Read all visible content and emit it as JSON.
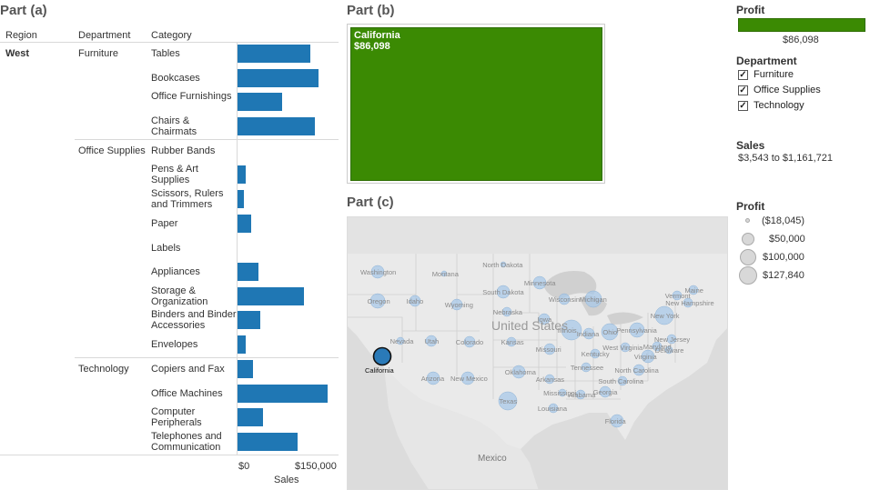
{
  "part_a": {
    "title": "Part (a)",
    "headers": {
      "region": "Region",
      "department": "Department",
      "category": "Category"
    },
    "region": "West",
    "departments": [
      "Furniture",
      "Office Supplies",
      "Technology"
    ],
    "rows": [
      {
        "dept": "Furniture",
        "category": "Tables",
        "sales": 110000
      },
      {
        "dept": "Furniture",
        "category": "Bookcases",
        "sales": 123000
      },
      {
        "dept": "Furniture",
        "category": "Office Furnishings",
        "sales": 68000
      },
      {
        "dept": "Furniture",
        "category": "Chairs & Chairmats",
        "sales": 117000
      },
      {
        "dept": "Office Supplies",
        "category": "Rubber Bands",
        "sales": 0
      },
      {
        "dept": "Office Supplies",
        "category": "Pens & Art Supplies",
        "sales": 13000
      },
      {
        "dept": "Office Supplies",
        "category": "Scissors, Rulers and Trimmers",
        "sales": 10000
      },
      {
        "dept": "Office Supplies",
        "category": "Paper",
        "sales": 21000
      },
      {
        "dept": "Office Supplies",
        "category": "Labels",
        "sales": 0
      },
      {
        "dept": "Office Supplies",
        "category": "Appliances",
        "sales": 32000
      },
      {
        "dept": "Office Supplies",
        "category": "Storage & Organization",
        "sales": 101000
      },
      {
        "dept": "Office Supplies",
        "category": "Binders and Binder Accessories",
        "sales": 34000
      },
      {
        "dept": "Office Supplies",
        "category": "Envelopes",
        "sales": 13000
      },
      {
        "dept": "Technology",
        "category": "Copiers and Fax",
        "sales": 24000
      },
      {
        "dept": "Technology",
        "category": "Office Machines",
        "sales": 137000
      },
      {
        "dept": "Technology",
        "category": "Computer Peripherals",
        "sales": 38000
      },
      {
        "dept": "Technology",
        "category": "Telephones and Communication",
        "sales": 91000
      }
    ],
    "axis": {
      "ticks": [
        "$0",
        "$150,000"
      ],
      "label": "Sales",
      "max": 150000
    }
  },
  "part_b": {
    "title": "Part (b)",
    "state": "California",
    "value": "$86,098",
    "color": "#3b8a03"
  },
  "part_c": {
    "title": "Part (c)",
    "country": "United States",
    "neighbor": "Mexico",
    "selected_state": "California",
    "states": [
      "Washington",
      "Oregon",
      "Idaho",
      "Montana",
      "North Dakota",
      "South Dakota",
      "Wyoming",
      "Nebraska",
      "Minnesota",
      "Wisconsin",
      "Michigan",
      "Iowa",
      "Illinois",
      "Indiana",
      "Ohio",
      "Nevada",
      "Utah",
      "Colorado",
      "Kansas",
      "Missouri",
      "Kentucky",
      "Tennessee",
      "Arizona",
      "New Mexico",
      "Oklahoma",
      "Arkansas",
      "Mississippi",
      "Alabama",
      "Georgia",
      "South Carolina",
      "North Carolina",
      "Texas",
      "Louisiana",
      "Florida",
      "Pennsylvania",
      "New York",
      "Vermont",
      "New Hampshire",
      "Maine",
      "New Jersey",
      "Maryland",
      "West Virginia",
      "Virginia",
      "Delaware"
    ]
  },
  "legend": {
    "profit_title": "Profit",
    "profit_value": "$86,098",
    "profit_color": "#3b8a03",
    "department_title": "Department",
    "departments": [
      "Furniture",
      "Office Supplies",
      "Technology"
    ],
    "sales_title": "Sales",
    "sales_range": "$3,543 to $1,161,721",
    "size_title": "Profit",
    "size_items": [
      "($18,045)",
      "$50,000",
      "$100,000",
      "$127,840"
    ]
  }
}
